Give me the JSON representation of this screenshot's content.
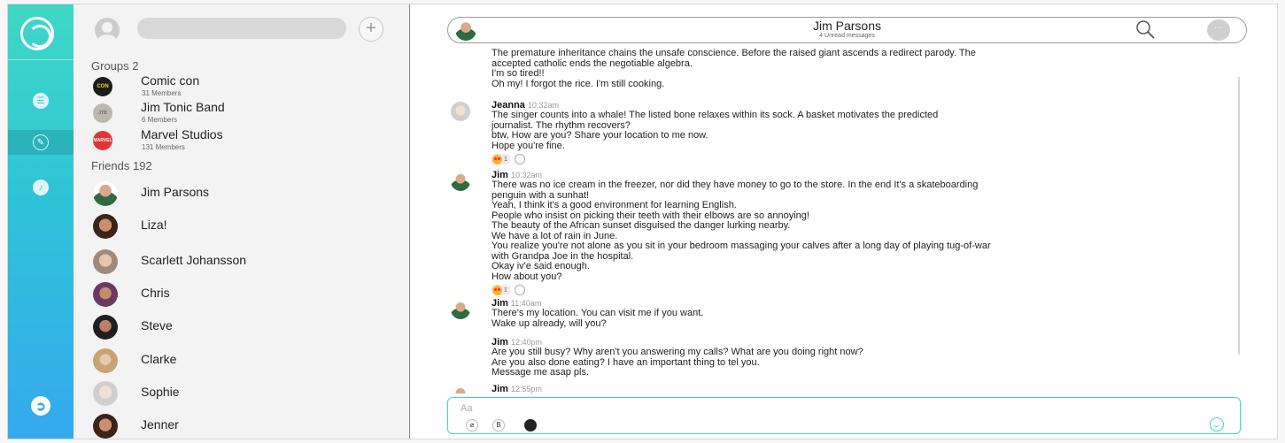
{
  "colors": {
    "accent": "#3fd8c5",
    "accent_blue": "#34a9ee",
    "composer_border": "#44d1c3",
    "marvel_red": "#e23636"
  },
  "sidebar": {
    "add_label": "+",
    "groups_title": "Groups 2",
    "groups": [
      {
        "name": "Comic con",
        "sub": "31 Members",
        "avatar_text": "CON"
      },
      {
        "name": "Jim Tonic Band",
        "sub": "6 Members",
        "avatar_text": "JTB"
      },
      {
        "name": "Marvel Studios",
        "sub": "131 Members",
        "avatar_text": "MARVEL"
      }
    ],
    "friends_title": "Friends 192",
    "friends": [
      {
        "name": "Jim Parsons"
      },
      {
        "name": "Liza!"
      },
      {
        "name": "Scarlett Johansson"
      },
      {
        "name": "Chris"
      },
      {
        "name": "Steve"
      },
      {
        "name": "Clarke"
      },
      {
        "name": "Sophie"
      },
      {
        "name": "Jenner"
      }
    ]
  },
  "chat": {
    "title": "Jim Parsons",
    "subtitle": "4 Unread messages",
    "more_label": "···",
    "messages": [
      {
        "sender": "",
        "time": "",
        "lines": [
          "The premature inheritance chains the unsafe conscience. Before the raised giant ascends a redirect parody. The",
          "accepted catholic ends the negotiable algebra.",
          "I'm so tired!!",
          "Oh my! I forgot the rice. I'm still cooking."
        ]
      },
      {
        "sender": "Jeanna",
        "time": "10:32am",
        "lines": [
          "The singer counts into a whale! The listed bone relaxes within its sock. A basket motivates the predicted",
          "journalist. The rhythm recovers?",
          "btw, How are you? Share your location to me now.",
          "Hope you're fine."
        ],
        "reaction_count": "1"
      },
      {
        "sender": "Jim",
        "time": "10:32am",
        "lines": [
          "There was no ice cream in the freezer, nor did they have money to go to the store. In the end It's a skateboarding",
          "penguin with a sunhat!",
          "Yeah, I think it's a good environment for learning English.",
          "People who insist on picking their teeth with their elbows are so annoying!",
          "The beauty of the African sunset disguised the danger lurking nearby.",
          "We have a lot of rain in June.",
          "You realize you're not alone as you sit in your bedroom massaging your calves after a long day of playing tug-of-war",
          "with Grandpa Joe in the hospital.",
          "Okay iv'e said enough.",
          "How about you?"
        ],
        "reaction_count": "1"
      },
      {
        "sender": "Jim",
        "time": "11:40am",
        "lines": [
          "There's my location. You can visit me if you want.",
          "Wake up already, will you?"
        ]
      },
      {
        "sender": "Jim",
        "time": "12:40pm",
        "lines": [
          "Are you still busy?  Why aren't you answering my calls? What are you doing right now?",
          "Are you also done eating? I have an important thing to tel you.",
          "Message me asap pls."
        ]
      },
      {
        "sender": "Jim",
        "time": "12:55pm",
        "lines": []
      }
    ],
    "composer": {
      "placeholder": "Aa",
      "attach_icon": "attach-icon",
      "bold_label": "B"
    }
  }
}
